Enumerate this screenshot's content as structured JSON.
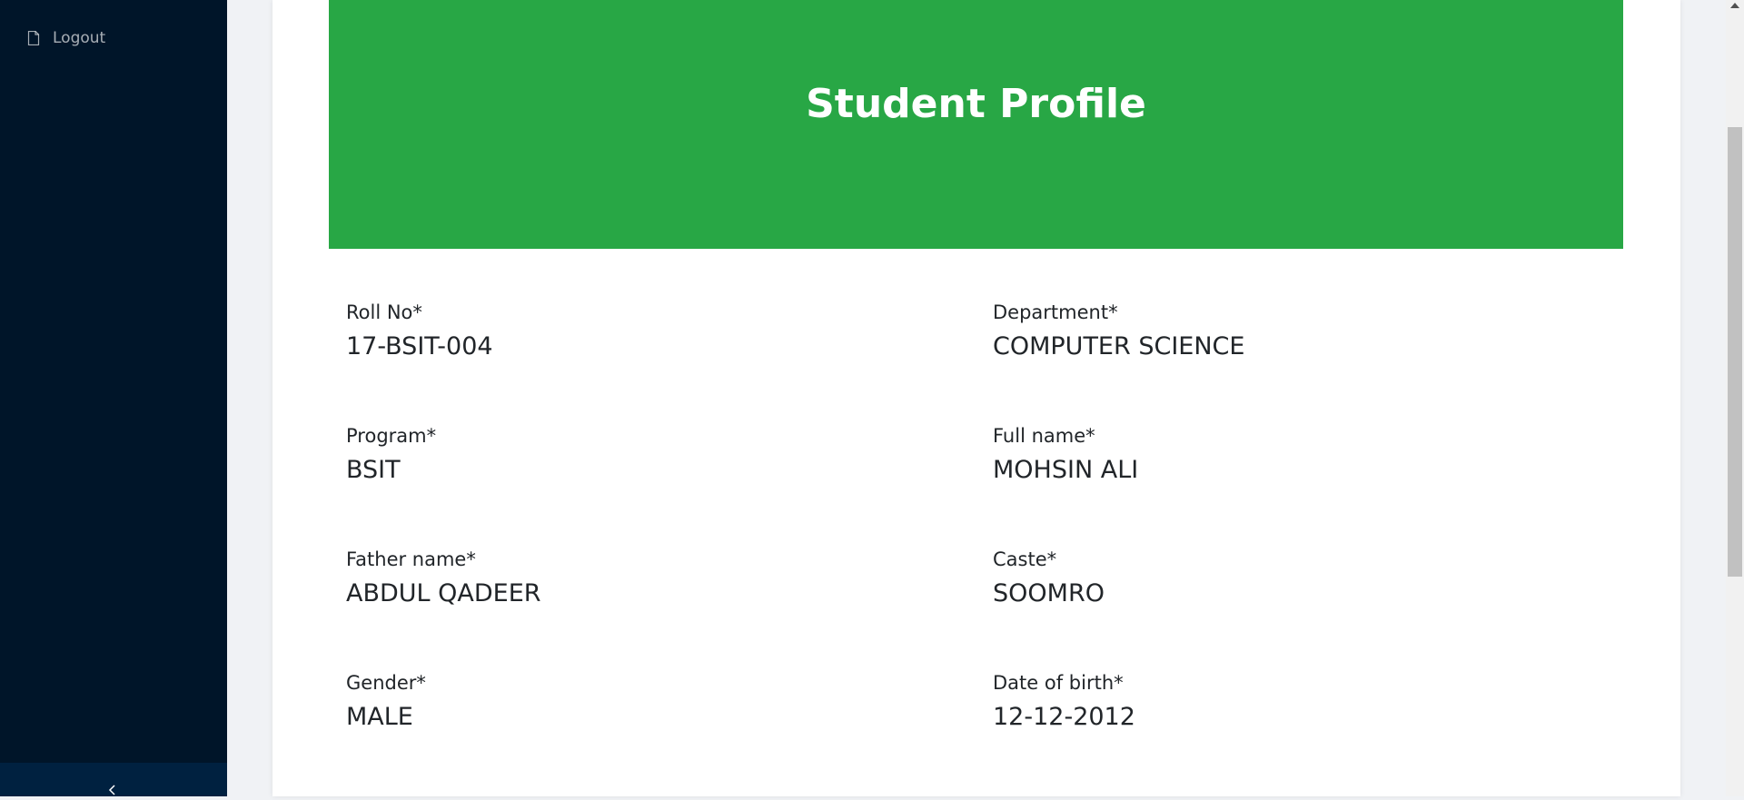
{
  "sidebar": {
    "items": [
      {
        "label": "Logout",
        "icon": "file-icon"
      }
    ],
    "collapse_icon": "chevron-left-icon"
  },
  "banner": {
    "title": "Student Profile",
    "color": "#28a745"
  },
  "profile": {
    "fields": [
      {
        "label": "Roll No*",
        "value": "17-BSIT-004"
      },
      {
        "label": "Department*",
        "value": "COMPUTER SCIENCE"
      },
      {
        "label": "Program*",
        "value": "BSIT"
      },
      {
        "label": "Full name*",
        "value": "MOHSIN ALI"
      },
      {
        "label": "Father name*",
        "value": "ABDUL QADEER"
      },
      {
        "label": "Caste*",
        "value": "SOOMRO"
      },
      {
        "label": "Gender*",
        "value": "MALE"
      },
      {
        "label": "Date of birth*",
        "value": "12-12-2012"
      }
    ]
  },
  "colors": {
    "sidebar_bg": "#001529",
    "accent_green": "#28a745"
  }
}
